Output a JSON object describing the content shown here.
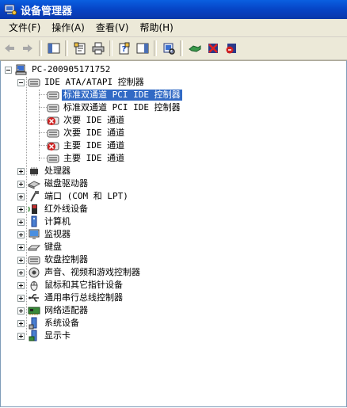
{
  "window": {
    "title": "设备管理器"
  },
  "menu": [
    {
      "label": "文件(F)"
    },
    {
      "label": "操作(A)"
    },
    {
      "label": "查看(V)"
    },
    {
      "label": "帮助(H)"
    }
  ],
  "tree": {
    "root": "PC-200905171752",
    "ide_group": "IDE ATA/ATAPI 控制器",
    "ide_children": [
      {
        "label": "标准双通道 PCI IDE 控制器",
        "selected": true,
        "error": false
      },
      {
        "label": "标准双通道 PCI IDE 控制器",
        "selected": false,
        "error": false
      },
      {
        "label": "次要 IDE 通道",
        "selected": false,
        "error": true
      },
      {
        "label": "次要 IDE 通道",
        "selected": false,
        "error": false
      },
      {
        "label": "主要 IDE 通道",
        "selected": false,
        "error": true
      },
      {
        "label": "主要 IDE 通道",
        "selected": false,
        "error": false
      }
    ],
    "categories": [
      {
        "label": "处理器",
        "icon": "cpu-icon"
      },
      {
        "label": "磁盘驱动器",
        "icon": "disk-drive-icon"
      },
      {
        "label": "端口 (COM 和 LPT)",
        "icon": "port-icon"
      },
      {
        "label": "红外线设备",
        "icon": "infrared-icon"
      },
      {
        "label": "计算机",
        "icon": "computer-icon"
      },
      {
        "label": "监视器",
        "icon": "monitor-icon"
      },
      {
        "label": "键盘",
        "icon": "keyboard-icon"
      },
      {
        "label": "软盘控制器",
        "icon": "floppy-controller-icon"
      },
      {
        "label": "声音、视频和游戏控制器",
        "icon": "sound-icon"
      },
      {
        "label": "鼠标和其它指针设备",
        "icon": "mouse-icon"
      },
      {
        "label": "通用串行总线控制器",
        "icon": "usb-icon"
      },
      {
        "label": "网络适配器",
        "icon": "network-icon"
      },
      {
        "label": "系统设备",
        "icon": "system-device-icon"
      },
      {
        "label": "显示卡",
        "icon": "display-adapter-icon"
      }
    ]
  }
}
